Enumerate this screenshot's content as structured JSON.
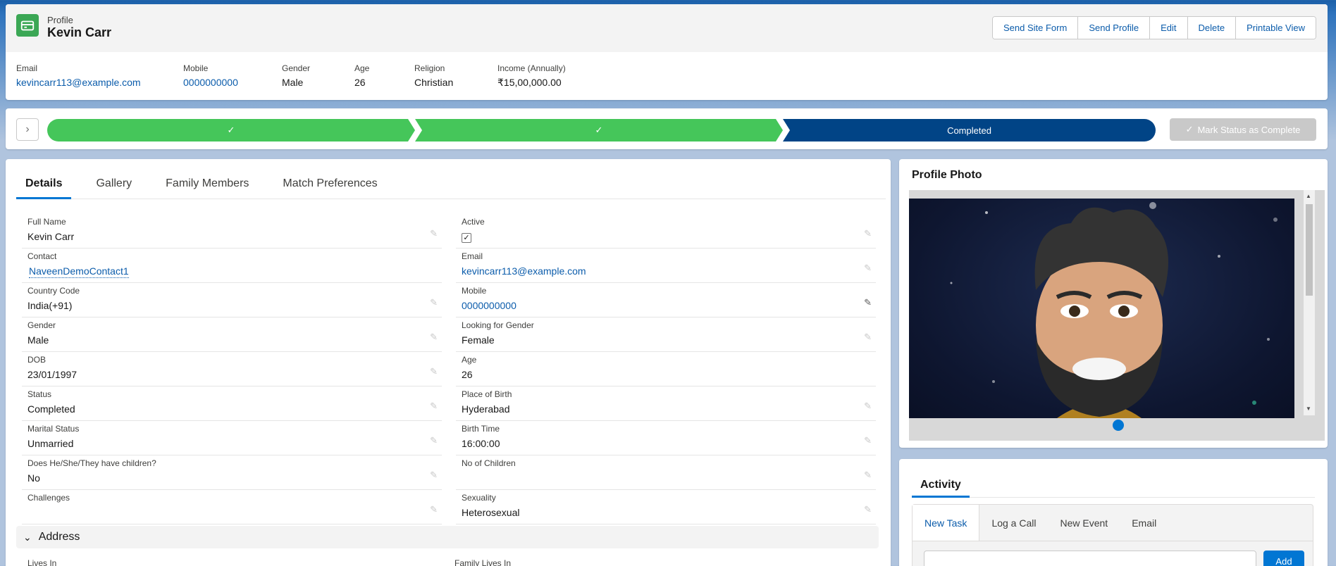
{
  "header": {
    "object_type": "Profile",
    "record_name": "Kevin Carr",
    "actions": [
      "Send Site Form",
      "Send Profile",
      "Edit",
      "Delete",
      "Printable View"
    ],
    "highlights": [
      {
        "label": "Email",
        "value": "kevincarr113@example.com",
        "link": true
      },
      {
        "label": "Mobile",
        "value": "0000000000",
        "link": true
      },
      {
        "label": "Gender",
        "value": "Male",
        "link": false
      },
      {
        "label": "Age",
        "value": "26",
        "link": false
      },
      {
        "label": "Religion",
        "value": "Christian",
        "link": false
      },
      {
        "label": "Income (Annually)",
        "value": "₹15,00,000.00",
        "link": false
      }
    ]
  },
  "path": {
    "stage3_label": "Completed",
    "mark_button": "Mark Status as Complete",
    "colors": {
      "complete": "#45c65a",
      "current": "#014486"
    }
  },
  "details": {
    "tabs": [
      "Details",
      "Gallery",
      "Family Members",
      "Match Preferences"
    ],
    "active_tab": "Details",
    "fields": [
      {
        "label": "Full Name",
        "value": "Kevin Carr"
      },
      {
        "label": "Active",
        "value": "✓"
      },
      {
        "label": "Contact",
        "value": "NaveenDemoContact1"
      },
      {
        "label": "Email",
        "value": "kevincarr113@example.com"
      },
      {
        "label": "Country Code",
        "value": "India(+91)"
      },
      {
        "label": "Mobile",
        "value": "0000000000"
      },
      {
        "label": "Gender",
        "value": "Male"
      },
      {
        "label": "Looking for Gender",
        "value": "Female"
      },
      {
        "label": "DOB",
        "value": "23/01/1997"
      },
      {
        "label": "Age",
        "value": "26"
      },
      {
        "label": "Status",
        "value": "Completed"
      },
      {
        "label": "Place of Birth",
        "value": "Hyderabad"
      },
      {
        "label": "Marital Status",
        "value": "Unmarried"
      },
      {
        "label": "Birth Time",
        "value": "16:00:00"
      },
      {
        "label": "Does He/She/They have children?",
        "value": "No"
      },
      {
        "label": "No of Children",
        "value": ""
      },
      {
        "label": "Challenges",
        "value": ""
      },
      {
        "label": "Sexuality",
        "value": "Heterosexual"
      }
    ],
    "section_address": "Address",
    "cut_labels": [
      "Lives In",
      "Family Lives In"
    ]
  },
  "photo": {
    "title": "Profile Photo"
  },
  "activity": {
    "title": "Activity",
    "publisher_tabs": [
      "New Task",
      "Log a Call",
      "New Event",
      "Email"
    ],
    "add_button": "Add"
  }
}
